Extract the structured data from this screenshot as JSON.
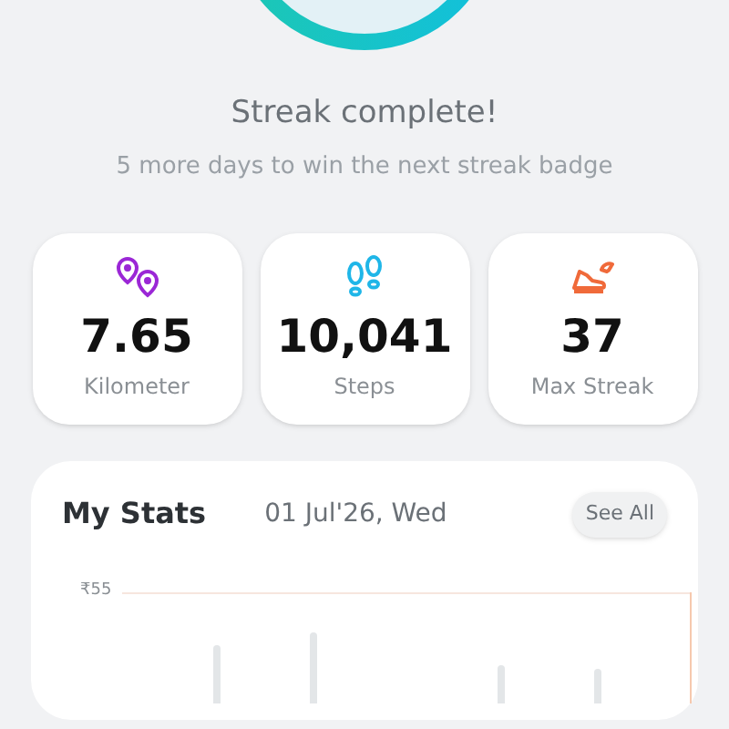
{
  "streak": {
    "title": "Streak complete!",
    "subtitle": "5 more days to win the next streak badge"
  },
  "metrics": [
    {
      "kind": "distance",
      "value": "7.65",
      "label": "Kilometer"
    },
    {
      "kind": "steps",
      "value": "10,041",
      "label": "Steps"
    },
    {
      "kind": "streak",
      "value": "37",
      "label": "Max Streak"
    }
  ],
  "stats": {
    "title": "My Stats",
    "date": "01 Jul'26, Wed",
    "see_all": "See All",
    "y_tick": "₹55"
  }
}
